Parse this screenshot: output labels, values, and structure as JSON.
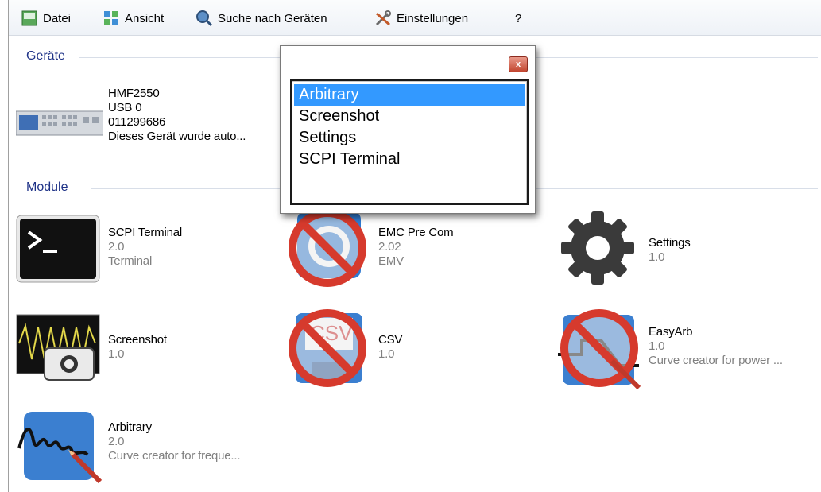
{
  "menu": {
    "datei": "Datei",
    "ansicht": "Ansicht",
    "suche": "Suche nach Geräten",
    "einstellungen": "Einstellungen",
    "help": "?"
  },
  "sections": {
    "devices": "Geräte",
    "modules": "Module"
  },
  "device": {
    "model": "HMF2550",
    "port": "USB 0",
    "serial": "011299686",
    "note": "Dieses Gerät wurde auto..."
  },
  "modules": [
    {
      "name": "SCPI Terminal",
      "version": "2.0",
      "desc": "Terminal",
      "icon": "terminal-icon"
    },
    {
      "name": "EMC Pre Com",
      "version": "2.02",
      "desc": "EMV",
      "icon": "emc-icon"
    },
    {
      "name": "Settings",
      "version": "1.0",
      "desc": "",
      "icon": "gear-icon"
    },
    {
      "name": "Screenshot",
      "version": "1.0",
      "desc": "",
      "icon": "screenshot-icon"
    },
    {
      "name": "CSV",
      "version": "1.0",
      "desc": "",
      "icon": "csv-icon"
    },
    {
      "name": "EasyArb",
      "version": "1.0",
      "desc": "Curve creator for power ...",
      "icon": "easyarb-icon"
    },
    {
      "name": "Arbitrary",
      "version": "2.0",
      "desc": "Curve creator for freque...",
      "icon": "arbitrary-icon"
    }
  ],
  "popup": {
    "close": "x",
    "items": [
      "Arbitrary",
      "Screenshot",
      "Settings",
      "SCPI Terminal"
    ],
    "selected": "Arbitrary"
  },
  "colors": {
    "section_text": "#1e3287",
    "selection": "#3399ff",
    "disabled_overlay": "#d32f2f"
  }
}
